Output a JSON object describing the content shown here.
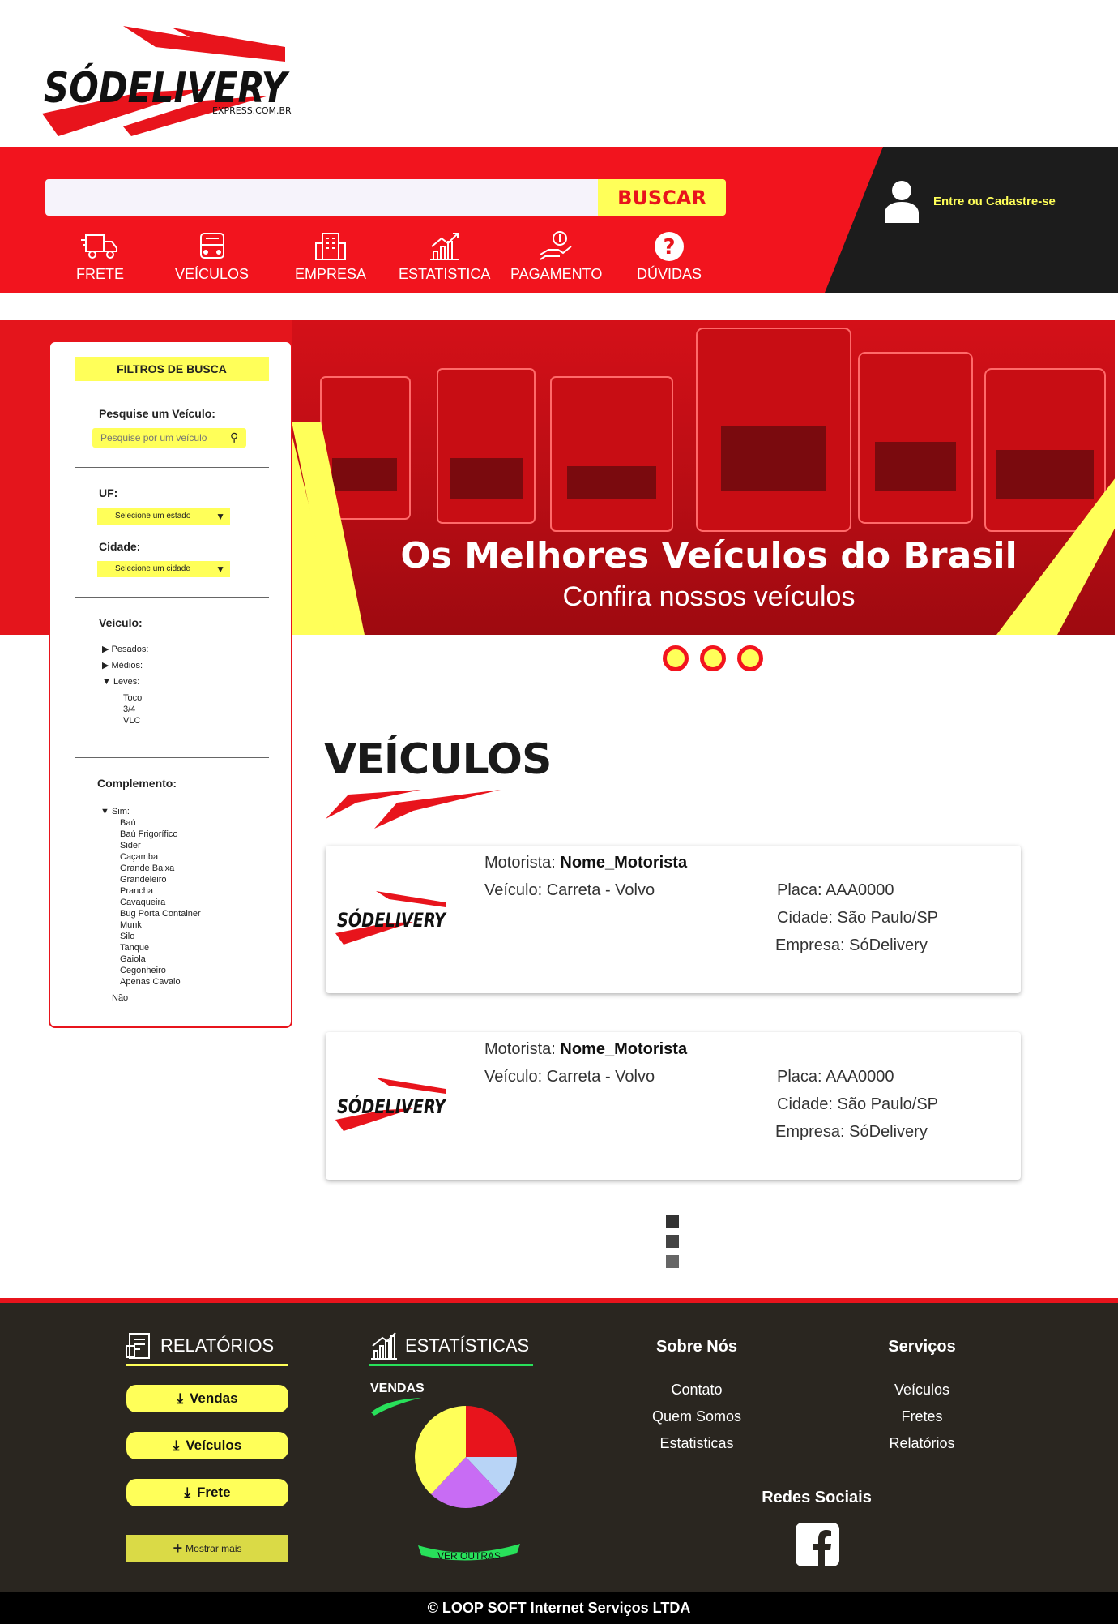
{
  "brand": {
    "logo_text": "SÓDELIVERY",
    "logo_sub": "EXPRESS.COM.BR",
    "red": "#f2141e",
    "yellow": "#ffff59",
    "dark": "#1c1c1c"
  },
  "header": {
    "search_placeholder": "",
    "search_button": "BUSCAR",
    "login_label": "Entre ou Cadastre-se",
    "nav": [
      {
        "label": "FRETE",
        "icon": "truck-icon"
      },
      {
        "label": "VEÍCULOS",
        "icon": "bus-icon"
      },
      {
        "label": "EMPRESA",
        "icon": "building-icon"
      },
      {
        "label": "ESTATISTICA",
        "icon": "chart-icon"
      },
      {
        "label": "PAGAMENTO",
        "icon": "payment-hand-icon"
      },
      {
        "label": "DÚVIDAS",
        "icon": "question-icon"
      }
    ]
  },
  "banner": {
    "title": "Os Melhores Veículos do Brasil",
    "subtitle": "Confira nossos veículos",
    "slides": 3
  },
  "sidebar": {
    "title": "FILTROS DE BUSCA",
    "search_label": "Pesquise um Veículo:",
    "search_placeholder": "Pesquise por um veículo",
    "uf_label": "UF:",
    "uf_select": "Selecione um estado",
    "city_label": "Cidade:",
    "city_select": "Selecione um cidade",
    "vehicle_label": "Veículo:",
    "vehicle_tree": {
      "pesados": "▶ Pesados:",
      "medios": "▶ Médios:",
      "leves": "▼ Leves:",
      "leves_items": [
        "Toco",
        "3/4",
        "VLC"
      ]
    },
    "complement_label": "Complemento:",
    "complement_tree": {
      "sim": "▼ Sim:",
      "sim_items": [
        "Baú",
        "Baú Frigorífico",
        "Sider",
        "Caçamba",
        "Grande Baixa",
        "Grandeleiro",
        "Prancha",
        "Cavaqueira",
        "Bug Porta Container",
        "Munk",
        "Silo",
        "Tanque",
        "Gaiola",
        "Cegonheiro",
        "Apenas Cavalo"
      ],
      "nao": "Não"
    }
  },
  "main": {
    "heading": "VEÍCULOS",
    "cards": [
      {
        "motorista_label": "Motorista:",
        "motorista": "Nome_Motorista",
        "veiculo": "Veículo: Carreta - Volvo",
        "placa": "Placa: AAA0000",
        "cidade": "Cidade: São Paulo/SP",
        "empresa": "Empresa: SóDelivery"
      },
      {
        "motorista_label": "Motorista:",
        "motorista": "Nome_Motorista",
        "veiculo": "Veículo: Carreta - Volvo",
        "placa": "Placa: AAA0000",
        "cidade": "Cidade: São Paulo/SP",
        "empresa": "Empresa: SóDelivery"
      }
    ]
  },
  "footer": {
    "reports_title": "RELATÓRIOS",
    "reports_buttons": [
      "Vendas",
      "Veículos",
      "Frete"
    ],
    "show_more": "Mostrar mais",
    "stats_title": "ESTATÍSTICAS",
    "stats_sub": "VENDAS",
    "stats_more": "VER OUTRAS",
    "about_title": "Sobre Nós",
    "about_links": [
      "Contato",
      "Quem Somos",
      "Estatisticas"
    ],
    "services_title": "Serviços",
    "services_links": [
      "Veículos",
      "Fretes",
      "Relatórios"
    ],
    "social_title": "Redes Sociais",
    "copyright": "© LOOP SOFT Internet Serviços LTDA"
  }
}
